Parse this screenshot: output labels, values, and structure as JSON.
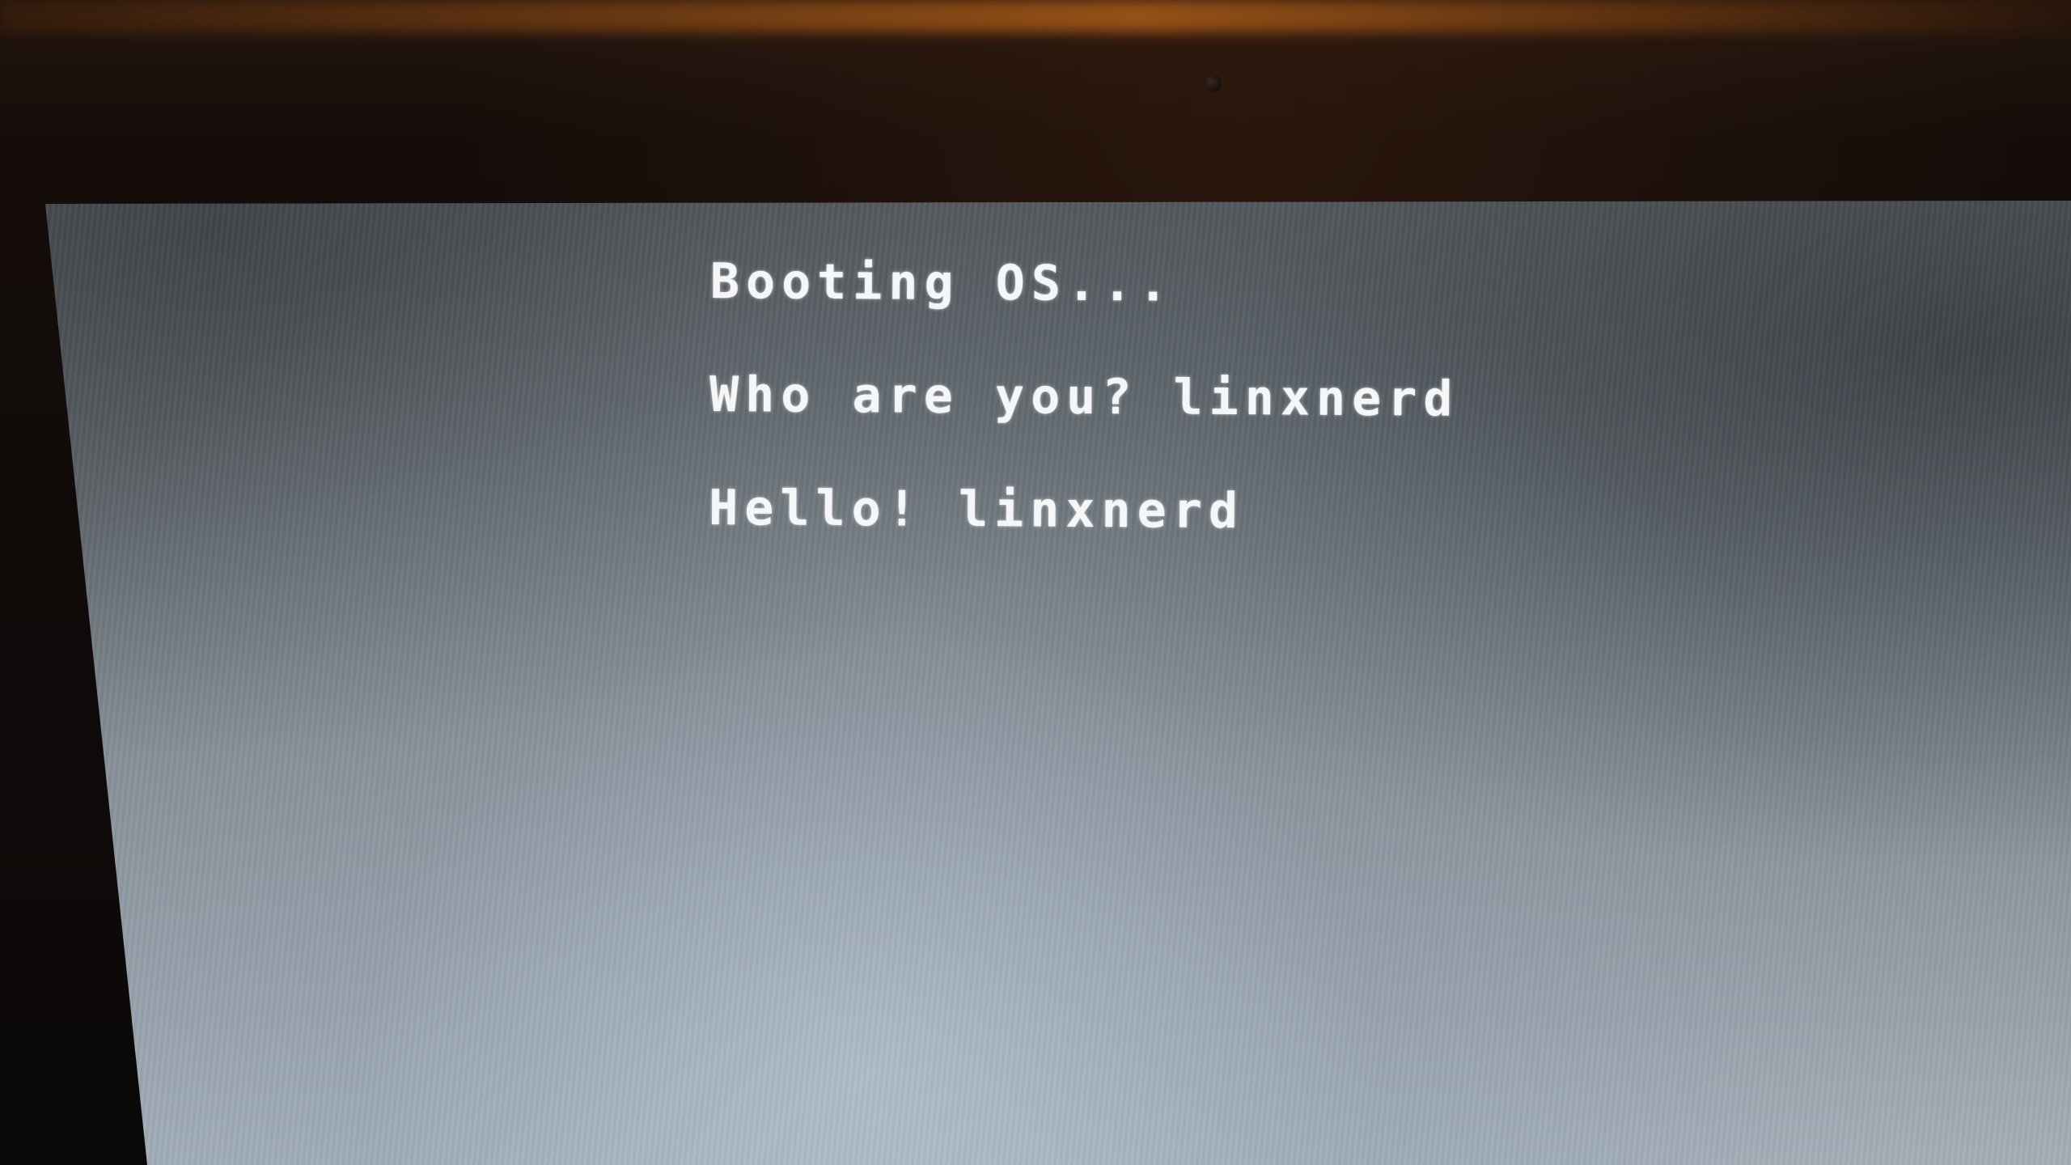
{
  "console": {
    "lines": [
      {
        "text": "Booting OS..."
      },
      {
        "text": "Who are you? linxnerd"
      },
      {
        "text": "Hello! linxnerd"
      }
    ]
  },
  "colors": {
    "text": "#f4f6f8",
    "screen_background": "#6a7176",
    "bezel": "#140d0a"
  }
}
